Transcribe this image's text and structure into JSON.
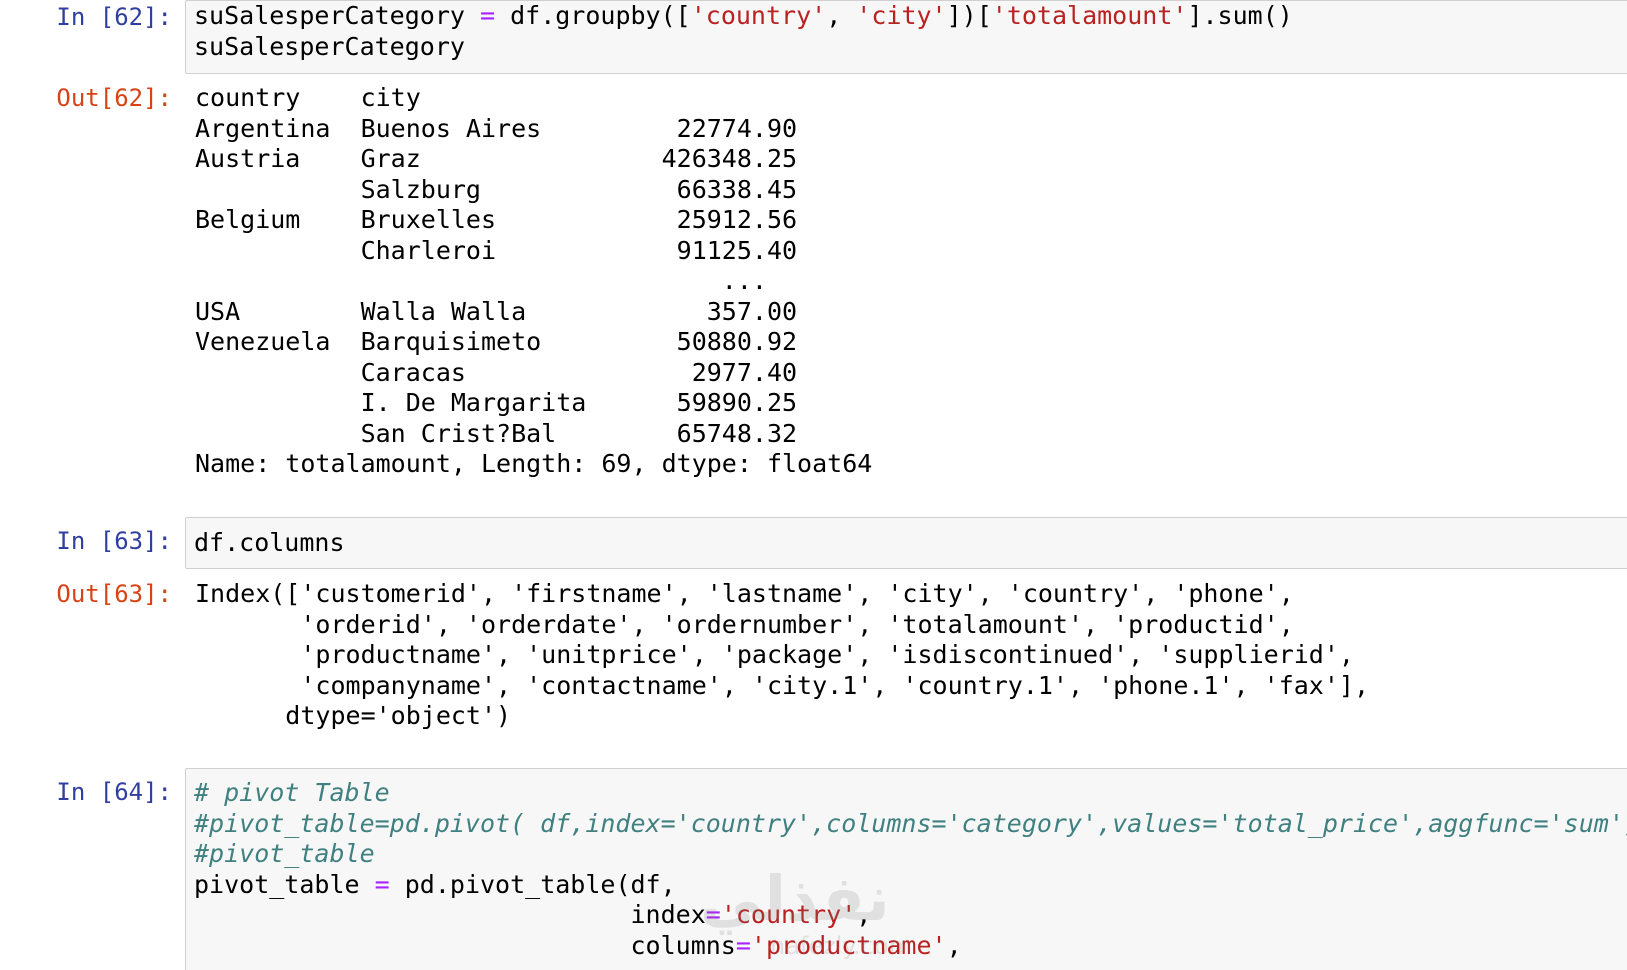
{
  "cells": [
    {
      "prompt": "In [62]:",
      "code_lines": [
        [
          {
            "t": "suSalesperCategory ",
            "c": "plain"
          },
          {
            "t": "=",
            "c": "op"
          },
          {
            "t": " df.groupby([",
            "c": "plain"
          },
          {
            "t": "'country'",
            "c": "str"
          },
          {
            "t": ", ",
            "c": "plain"
          },
          {
            "t": "'city'",
            "c": "str"
          },
          {
            "t": "])[",
            "c": "plain"
          },
          {
            "t": "'totalamount'",
            "c": "str"
          },
          {
            "t": "].sum()",
            "c": "plain"
          }
        ],
        [
          {
            "t": "suSalesperCategory",
            "c": "plain"
          }
        ]
      ]
    },
    {
      "prompt": "In [63]:",
      "code_lines": [
        [
          {
            "t": "df.columns",
            "c": "plain"
          }
        ]
      ]
    },
    {
      "prompt": "In [64]:",
      "code_lines": [
        [
          {
            "t": "# pivot Table",
            "c": "com"
          }
        ],
        [
          {
            "t": "#pivot_table=pd.pivot( df,index='country',columns='category',values='total_price',aggfunc='sum')",
            "c": "com"
          }
        ],
        [
          {
            "t": "#pivot_table",
            "c": "com"
          }
        ],
        [
          {
            "t": "pivot_table ",
            "c": "plain"
          },
          {
            "t": "=",
            "c": "op"
          },
          {
            "t": " pd.pivot_table(df,",
            "c": "plain"
          }
        ],
        [
          {
            "t": "                             index",
            "c": "plain"
          },
          {
            "t": "=",
            "c": "op"
          },
          {
            "t": "'country'",
            "c": "str"
          },
          {
            "t": ",",
            "c": "plain"
          }
        ],
        [
          {
            "t": "                             columns",
            "c": "plain"
          },
          {
            "t": "=",
            "c": "op"
          },
          {
            "t": "'productname'",
            "c": "str"
          },
          {
            "t": ",",
            "c": "plain"
          }
        ]
      ]
    }
  ],
  "outputs": [
    {
      "prompt": "Out[62]:",
      "lines": [
        "country    city",
        "Argentina  Buenos Aires         22774.90",
        "Austria    Graz                426348.25",
        "           Salzburg             66338.45",
        "Belgium    Bruxelles            25912.56",
        "           Charleroi            91125.40",
        "                                   ...",
        "USA        Walla Walla            357.00",
        "Venezuela  Barquisimeto         50880.92",
        "           Caracas               2977.40",
        "           I. De Margarita      59890.25",
        "           San Crist?Bal        65748.32",
        "Name: totalamount, Length: 69, dtype: float64"
      ]
    },
    {
      "prompt": "Out[63]:",
      "lines": [
        "Index(['customerid', 'firstname', 'lastname', 'city', 'country', 'phone',",
        "       'orderid', 'orderdate', 'ordernumber', 'totalamount', 'productid',",
        "       'productname', 'unitprice', 'package', 'isdiscontinued', 'supplierid',",
        "       'companyname', 'contactname', 'city.1', 'country.1', 'phone.1', 'fax'],",
        "      dtype='object')"
      ]
    }
  ],
  "watermark": {
    "text": "نفذلي",
    "sub": "nafezly.com"
  },
  "colors": {
    "in_prompt": "#303f9f",
    "out_prompt": "#d84315",
    "string": "#ba2121",
    "operator": "#aa22ff",
    "comment": "#408080",
    "cell_bg": "#f7f7f7",
    "cell_border": "#cfcfcf"
  }
}
